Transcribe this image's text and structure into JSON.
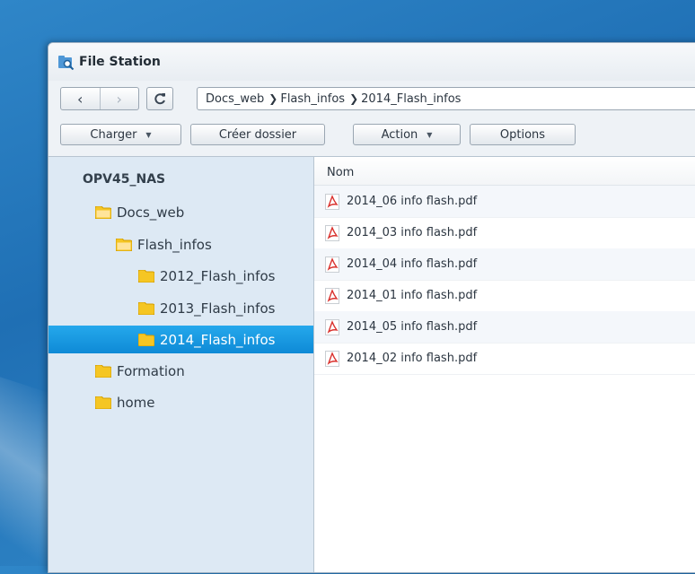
{
  "window": {
    "title": "File Station"
  },
  "nav": {
    "back": "‹",
    "forward": "›",
    "refresh": "C",
    "breadcrumbs": [
      "Docs_web",
      "Flash_infos",
      "2014_Flash_infos"
    ]
  },
  "toolbar": {
    "upload": "Charger",
    "create_folder": "Créer dossier",
    "action": "Action",
    "options": "Options"
  },
  "tree": {
    "root": "OPV45_NAS",
    "items": [
      {
        "label": "Docs_web",
        "level": 1
      },
      {
        "label": "Flash_infos",
        "level": 2
      },
      {
        "label": "2012_Flash_infos",
        "level": 3
      },
      {
        "label": "2013_Flash_infos",
        "level": 3
      },
      {
        "label": "2014_Flash_infos",
        "level": 3,
        "selected": true
      },
      {
        "label": "Formation",
        "level": 0
      },
      {
        "label": "home",
        "level": 0
      }
    ]
  },
  "files": {
    "column_name": "Nom",
    "rows": [
      "2014_06 info flash.pdf",
      "2014_03 info flash.pdf",
      "2014_04 info flash.pdf",
      "2014_01 info flash.pdf",
      "2014_05 info flash.pdf",
      "2014_02 info flash.pdf"
    ]
  },
  "colors": {
    "selection": "#1a9be3",
    "folder": "#f5c623",
    "pdf": "#d9302c",
    "desktop": "#2676bd"
  }
}
